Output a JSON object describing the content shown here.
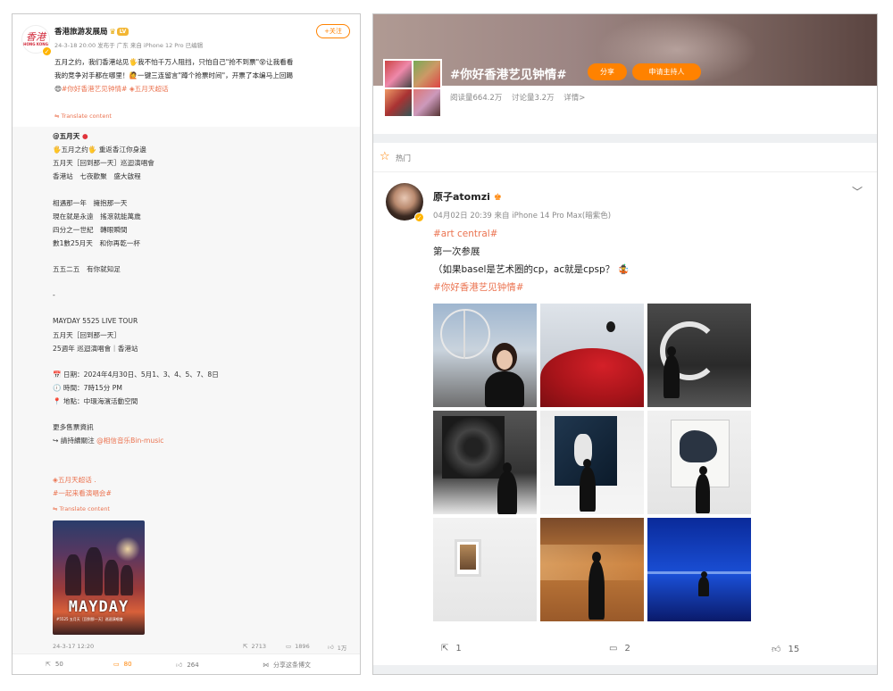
{
  "left_post": {
    "author": {
      "name": "香港旅游发展局",
      "crown_icon": "crown-icon",
      "level_badge": "LV",
      "avatar_glyph": "香港",
      "avatar_small": "HONG KONG",
      "verified_icon": "verified-badge-icon",
      "meta": "24-3-18 20:00 发布于 广东 来自 iPhone 12 Pro 已编辑"
    },
    "follow_label": "+关注",
    "text_lines": [
      "五月之约，我们香港站见🖐我不怕千万人阻挡，只怕自己\"抢不到票\"😵让我看看",
      "我的竞争对手都在哪里！🙋一键三连留言\"蹲个抢票时间\"，开票了本编马上回踢"
    ],
    "hashtag_line": {
      "prefix": "😍",
      "tag": "#你好香港艺见钟情#",
      "super": "五月天超话"
    },
    "translate_label": "Translate content",
    "repost": {
      "author_line": "@五月天",
      "lines": [
        "🖐五月之约🖐 重返香江你身邊",
        "五月天［回到那一天］巡迴演唱會",
        "香港站　七夜歡聚　盛大啟程",
        "相遇那一年　擁抱那一天",
        "現在就是永遠　搖滾就能萬歲",
        "四分之一世紀　轉眼瞬間",
        "數1數25月天　和你再乾一杯",
        "五五二五　有你就知足",
        "-",
        "MAYDAY 5525 LIVE TOUR",
        "五月天［回到那一天］",
        "25週年 巡迴演唱會｜香港站",
        "📅 日期：2024年4月30日、5月1、3、4、5、7、8日",
        "🕖 時間：7時15分 PM",
        "📍 地點：中環海濱活動空間",
        "更多售票資訊",
        "↪ 請持續關注",
        "五月天超话 .",
        "#一起来看演唱会#"
      ],
      "follow_link": "@相信音乐Bin-music",
      "translate_label": "Translate content",
      "poster_title": "MAYDAY",
      "poster_sub": "#5525 五月天［回到那一天］巡迴演唱會",
      "date": "24-3-17 12:20",
      "repost_count": "2713",
      "comment_count": "1896",
      "like_count": "1万"
    },
    "bar": {
      "repost": "50",
      "comment": "80",
      "like": "264",
      "share": "分享这条博文"
    }
  },
  "right_post": {
    "topic": {
      "title": "#你好香港艺见钟情#",
      "share_label": "分享",
      "host_label": "申请主持人",
      "reads": "阅读量664.2万",
      "discussions": "讨论量3.2万",
      "details": "详情>"
    },
    "hot_label": "热门",
    "author": {
      "name": "原子atomzi",
      "meta": "04月02日 20:39 来自 iPhone 14 Pro Max(暗紫色)"
    },
    "body": {
      "tag1": "#art central#",
      "line1": "第一次参展",
      "line2": "（如果basel是艺术圈的cp，ac就是cpsp？",
      "line2_emoji": "🤹",
      "tag2": "#你好香港艺见钟情#"
    },
    "bar": {
      "repost": "1",
      "comment": "2",
      "like": "15"
    }
  },
  "colors": {
    "accent": "#ff8200",
    "link": "#eb7350"
  }
}
